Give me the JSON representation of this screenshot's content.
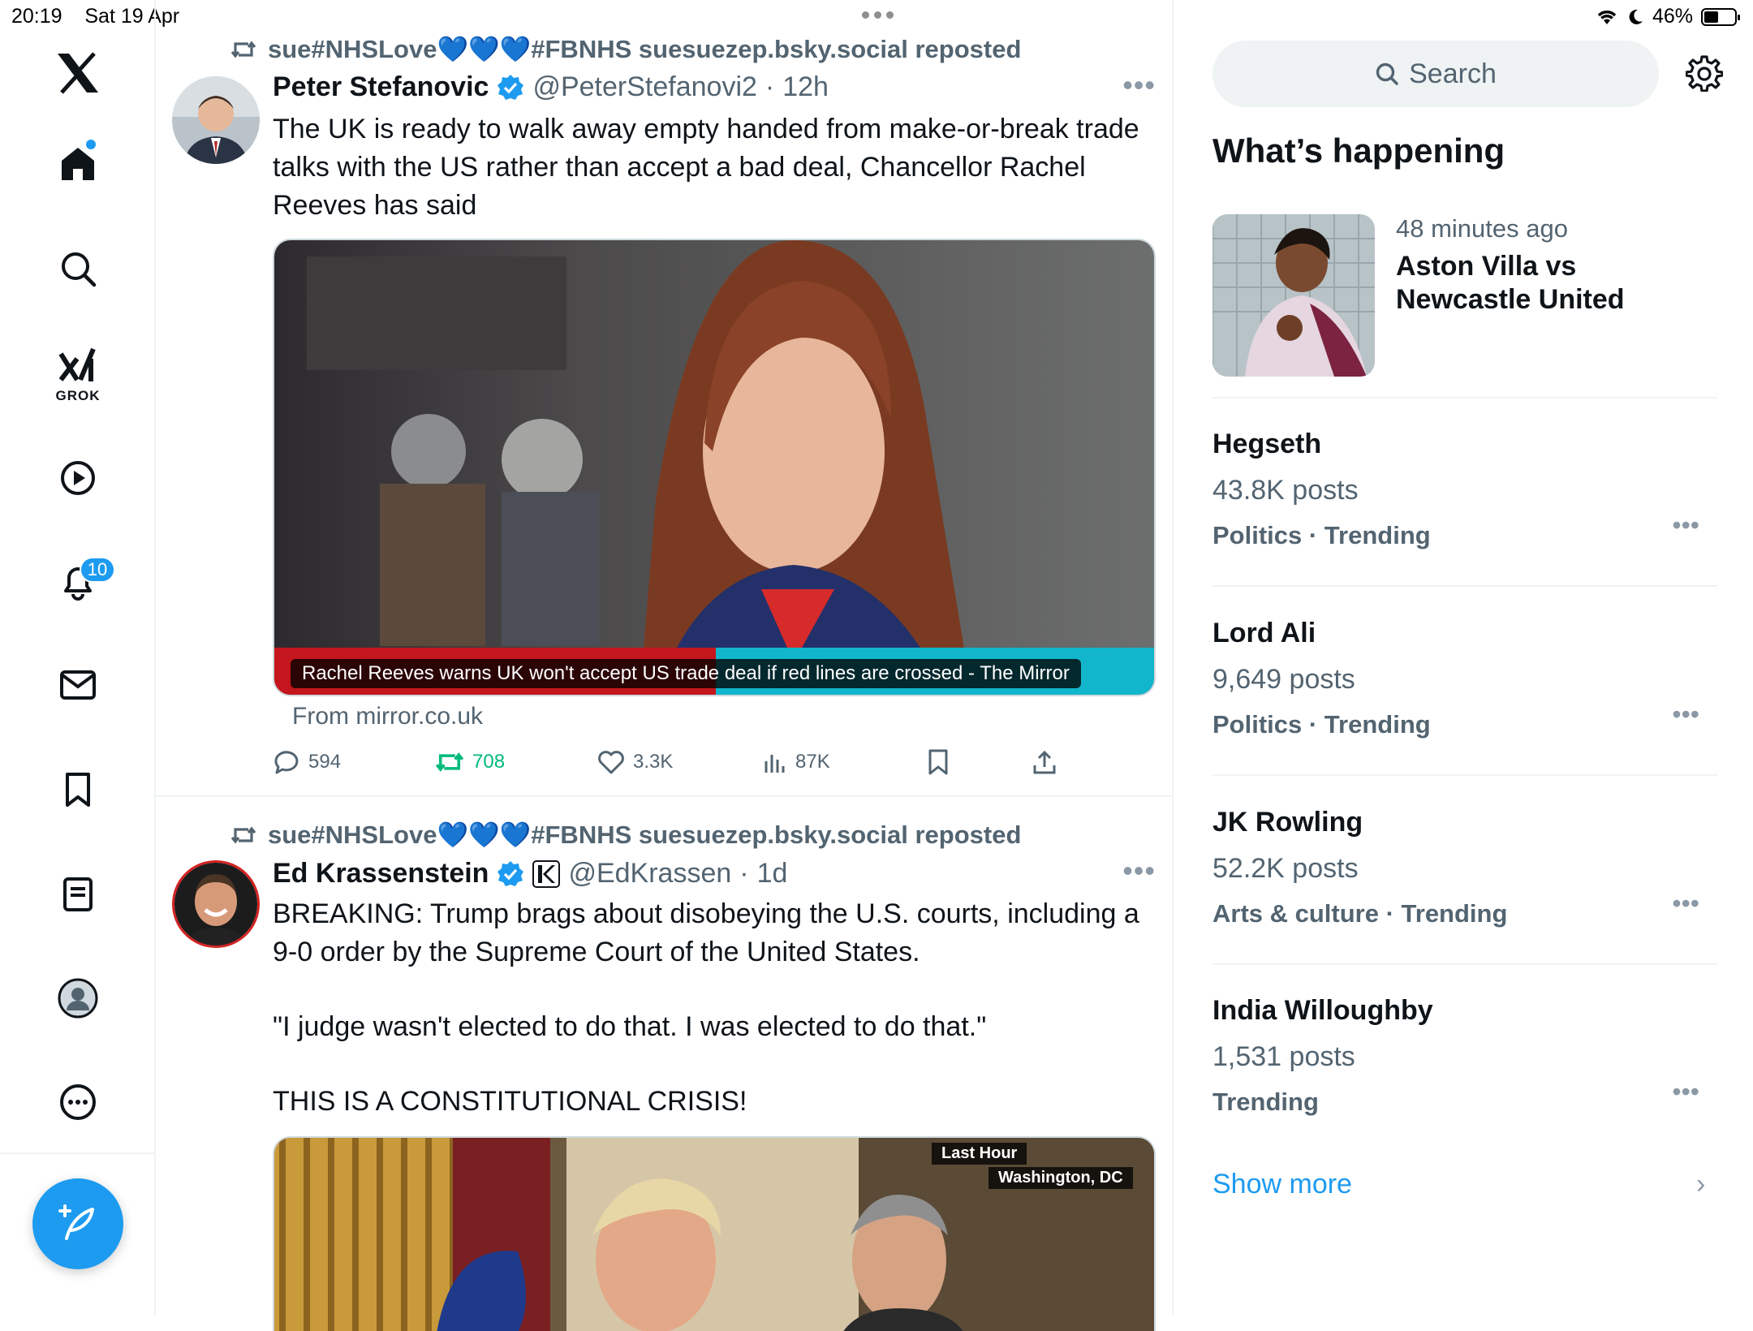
{
  "status_bar": {
    "time": "20:19",
    "date": "Sat 19 Apr",
    "battery": "46%",
    "battery_level": 0.46
  },
  "nav": {
    "items": [
      {
        "icon": "x-logo-icon"
      },
      {
        "icon": "home-icon"
      },
      {
        "icon": "search-icon"
      },
      {
        "icon": "grok-icon",
        "label": "GROK"
      },
      {
        "icon": "video-icon"
      },
      {
        "icon": "notifications-icon",
        "badge": "10"
      },
      {
        "icon": "messages-icon"
      },
      {
        "icon": "bookmarks-icon"
      },
      {
        "icon": "lists-icon"
      },
      {
        "icon": "profile-icon"
      },
      {
        "icon": "more-icon"
      }
    ],
    "compose_icon": "compose-icon"
  },
  "tweets": [
    {
      "repost_by": "sue#NHSLove💙💙💙#FBNHS suesuezep.bsky.social reposted",
      "name": "Peter Stefanovic",
      "handle": "@PeterStefanovi2",
      "time": "12h",
      "text": "The UK is ready to walk away empty handed from make-or-break trade talks with the US rather than accept a bad deal, Chancellor Rachel Reeves has said",
      "card_caption": "Rachel Reeves warns UK won't accept US trade deal if red lines are crossed - The Mirror",
      "from": "From mirror.co.uk",
      "replies": "594",
      "reposts": "708",
      "likes": "3.3K",
      "views": "87K"
    },
    {
      "repost_by": "sue#NHSLove💙💙💙#FBNHS suesuezep.bsky.social reposted",
      "name": "Ed Krassenstein",
      "handle": "@EdKrassen",
      "time": "1d",
      "text_1": "BREAKING: Trump brags about disobeying the U.S. courts, including a 9-0 order by the Supreme Court of the United States.",
      "text_2": "\"I judge wasn't elected to do that. I was elected to do that.\"",
      "text_3": "THIS IS A CONSTITUTIONAL CRISIS!",
      "video_overlay_1": "Last Hour",
      "video_overlay_2": "Washington, DC"
    }
  ],
  "sidebar": {
    "search_placeholder": "Search",
    "title": "What’s happening",
    "featured": {
      "time": "48 minutes ago",
      "title": "Aston Villa vs Newcastle United"
    },
    "trends": [
      {
        "name": "Hegseth",
        "count": "43.8K posts",
        "category": "Politics · Trending"
      },
      {
        "name": "Lord Ali",
        "count": "9,649 posts",
        "category": "Politics · Trending"
      },
      {
        "name": "JK Rowling",
        "count": "52.2K posts",
        "category": "Arts & culture · Trending"
      },
      {
        "name": "India Willoughby",
        "count": "1,531 posts",
        "category": "Trending"
      }
    ],
    "show_more": "Show more"
  },
  "colors": {
    "accent": "#1d9bf0",
    "repost_green": "#00ba7c",
    "secondary_text": "#536471",
    "border": "#eff3f4"
  }
}
